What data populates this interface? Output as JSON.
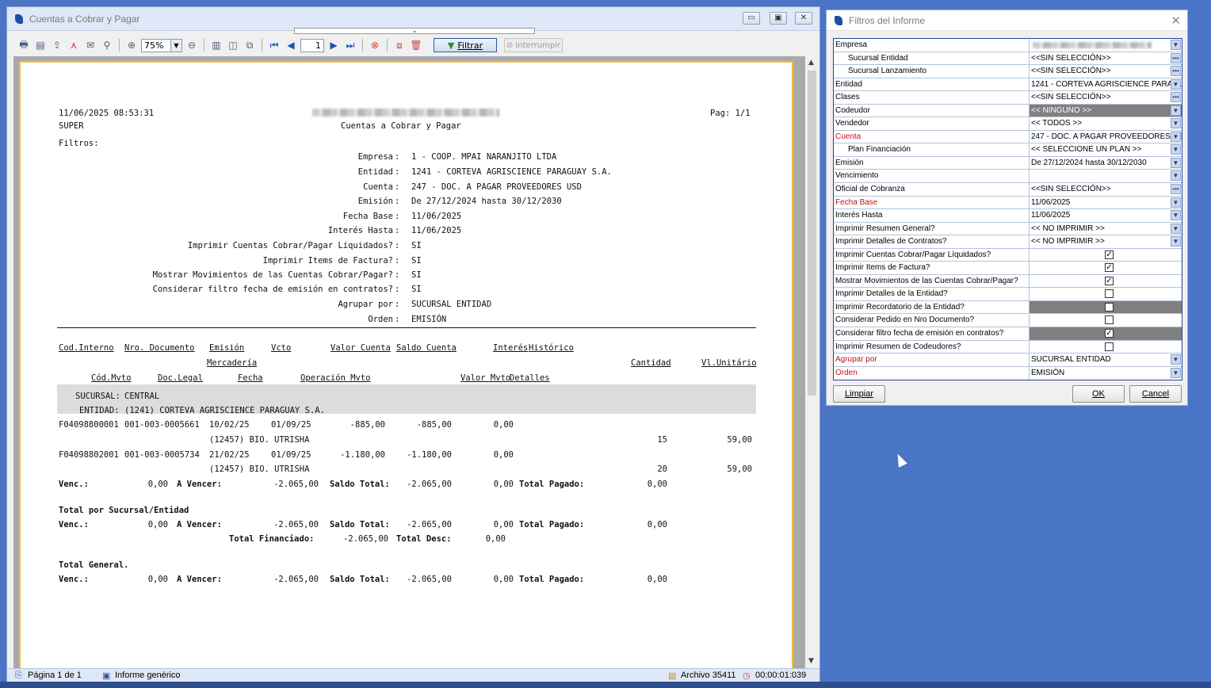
{
  "main_window": {
    "title": "Cuentas a Cobrar y Pagar",
    "toolbar": {
      "zoom": "75%",
      "page_input": "1",
      "filtrar_label": "Filtrar",
      "interrumpir_label": "Interrumpir"
    },
    "status": {
      "page": "Página 1 de 1",
      "report": "Informe genérico",
      "archivo": "Archivo 35411",
      "elapsed": "00:00:01:039"
    }
  },
  "report": {
    "datetime": "11/06/2025 08:53:31",
    "user": "SUPER",
    "title": "Cuentas a Cobrar y Pagar",
    "page": "Pag: 1/1",
    "filtros_label": "Filtros:",
    "filters": [
      {
        "label": "Empresa",
        "value": "1 - COOP. MPAI NARANJITO LTDA"
      },
      {
        "label": "Entidad",
        "value": "1241 - CORTEVA AGRISCIENCE PARAGUAY S.A."
      },
      {
        "label": "Cuenta",
        "value": "247 - DOC. A PAGAR PROVEEDORES USD"
      },
      {
        "label": "Emisión",
        "value": "De 27/12/2024 hasta 30/12/2030"
      },
      {
        "label": "Fecha Base",
        "value": "11/06/2025"
      },
      {
        "label": "Interés Hasta",
        "value": "11/06/2025"
      },
      {
        "label": "Imprimir Cuentas Cobrar/Pagar Líquidados?",
        "value": "SI"
      },
      {
        "label": "Imprimir Items de Factura?",
        "value": "SI"
      },
      {
        "label": "Mostrar Movimientos de las Cuentas Cobrar/Pagar?",
        "value": "SI"
      },
      {
        "label": "Considerar filtro fecha de emisión en contratos?",
        "value": "SI"
      },
      {
        "label": "Agrupar por",
        "value": "SUCURSAL ENTIDAD"
      },
      {
        "label": "Orden",
        "value": "EMISIÓN"
      }
    ],
    "headers": {
      "cod_interno": "Cod.Interno",
      "nro_documento": "Nro. Documento",
      "emision": "Emisión",
      "vcto": "Vcto",
      "valor_cuenta": "Valor Cuenta",
      "saldo_cuenta": "Saldo Cuenta",
      "interes": "Interés",
      "historico": "Histórico",
      "mercaderia": "Mercadería",
      "cantidad": "Cantidad",
      "vl_unitario": "Vl.Unitário",
      "cod_mvto": "Cód.Mvto",
      "doc_legal": "Doc.Legal",
      "fecha": "Fecha",
      "operacion_mvto": "Operación Mvto",
      "valor_mvto": "Valor Mvto",
      "detalles": "Detalles"
    },
    "group": {
      "sucursal_label": "SUCURSAL:",
      "sucursal": "CENTRAL",
      "entidad_label": "ENTIDAD:",
      "entidad": "(1241) CORTEVA AGRISCIENCE PARAGUAY S.A."
    },
    "rows": [
      {
        "cod": "F04098800001",
        "doc": "001-003-0005661",
        "emision": "10/02/25",
        "vcto": "01/09/25",
        "valor": "-885,00",
        "saldo": "-885,00",
        "interes": "0,00",
        "item": "(12457) BIO. UTRISHA",
        "cantidad": "15",
        "unitario": "59,00"
      },
      {
        "cod": "F04098802001",
        "doc": "001-003-0005734",
        "emision": "21/02/25",
        "vcto": "01/09/25",
        "valor": "-1.180,00",
        "saldo": "-1.180,00",
        "interes": "0,00",
        "item": "(12457) BIO. UTRISHA",
        "cantidad": "20",
        "unitario": "59,00"
      }
    ],
    "labels": {
      "venc": "Venc.:",
      "a_vencer": "A Vencer:",
      "saldo_total": "Saldo Total:",
      "total_pagado": "Total Pagado:",
      "total_sucursal": "Total por Sucursal/Entidad",
      "total_financiado": "Total Financiado:",
      "total_desc": "Total Desc:",
      "total_general": "Total General."
    },
    "totals": {
      "venc": "0,00",
      "a_vencer": "-2.065,00",
      "saldo_total": "-2.065,00",
      "interes": "0,00",
      "total_pagado": "0,00",
      "total_financiado": "-2.065,00",
      "total_desc": "0,00"
    }
  },
  "dialog": {
    "title": "Filtros del Informe",
    "rows": [
      {
        "label": "Empresa",
        "value": "",
        "type": "dropdown"
      },
      {
        "label": "Sucursal Entidad",
        "value": "<<SIN SELECCIÓN>>",
        "type": "ellipsis"
      },
      {
        "label": "Sucursal Lanzamiento",
        "value": "<<SIN SELECCIÓN>>",
        "type": "ellipsis"
      },
      {
        "label": "Entidad",
        "value": "1241 - CORTEVA AGRISCIENCE PARAGUAY S.A.",
        "type": "dropdown"
      },
      {
        "label": "Clases",
        "value": "<<SIN SELECCIÓN>>",
        "type": "ellipsis"
      },
      {
        "label": "Codeudor",
        "value": "<< NINGUNO >>",
        "type": "dropdown"
      },
      {
        "label": "Vendedor",
        "value": "<< TODOS >>",
        "type": "dropdown"
      },
      {
        "label": "Cuenta",
        "value": "247 - DOC. A PAGAR PROVEEDORES USD",
        "type": "dropdown"
      },
      {
        "label": "Plan Financiación",
        "value": "<< SELECCIONE UN PLAN >>",
        "type": "dropdown"
      },
      {
        "label": "Emisión",
        "value": "De 27/12/2024 hasta 30/12/2030",
        "type": "dropdown"
      },
      {
        "label": "Vencimiento",
        "value": "",
        "type": "dropdown"
      },
      {
        "label": "Oficial de Cobranza",
        "value": "<<SIN SELECCIÓN>>",
        "type": "ellipsis"
      },
      {
        "label": "Fecha Base",
        "value": "11/06/2025",
        "type": "dropdown"
      },
      {
        "label": "Interés Hasta",
        "value": "11/06/2025",
        "type": "dropdown"
      },
      {
        "label": "Imprimir Resumen General?",
        "value": "<< NO IMPRIMIR >>",
        "type": "dropdown"
      },
      {
        "label": "Imprimir Detalles de Contratos?",
        "value": "<< NO IMPRIMIR >>",
        "type": "dropdown"
      },
      {
        "label": "Imprimir Cuentas Cobrar/Pagar Líquidados?",
        "checked": true,
        "type": "check"
      },
      {
        "label": "Imprimir Items de Factura?",
        "checked": true,
        "type": "check"
      },
      {
        "label": "Mostrar Movimientos de las Cuentas Cobrar/Pagar?",
        "checked": true,
        "type": "check"
      },
      {
        "label": "Imprimir Detalles de la Entidad?",
        "checked": false,
        "type": "check"
      },
      {
        "label": "Imprimir Recordatorio de la Entidad?",
        "checked": false,
        "type": "check"
      },
      {
        "label": "Considerar Pedido en Nro Documento?",
        "checked": false,
        "type": "check"
      },
      {
        "label": "Considerar filtro fecha de emisión en contratos?",
        "checked": true,
        "type": "check"
      },
      {
        "label": "Imprimir Resumen de Codeudores?",
        "checked": false,
        "type": "check"
      },
      {
        "label": "Agrupar por",
        "value": "SUCURSAL ENTIDAD",
        "type": "dropdown"
      },
      {
        "label": "Orden",
        "value": "EMISIÓN",
        "type": "dropdown"
      }
    ],
    "buttons": {
      "limpiar": "Limpiar",
      "ok": "OK",
      "cancel": "Cancel"
    }
  },
  "colors": {
    "desktop": "#4a74c6",
    "required_label": "#c0141c",
    "page_border": "#f5b942"
  }
}
